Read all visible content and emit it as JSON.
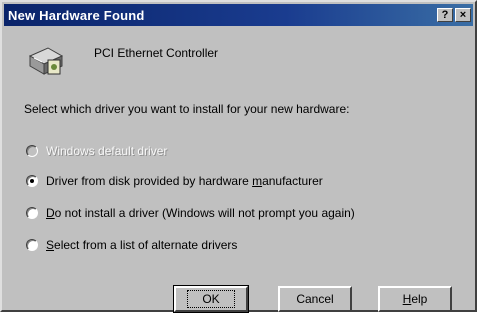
{
  "window": {
    "title": "New Hardware Found"
  },
  "titlebar_buttons": {
    "help": "?",
    "close": "×"
  },
  "device": {
    "name": "PCI Ethernet Controller",
    "icon": "hardware-device-icon"
  },
  "instruction": "Select which driver you want to install for your new hardware:",
  "options": [
    {
      "label": "Windows default driver",
      "checked": false,
      "disabled": true
    },
    {
      "label_pre": "Driver from disk provided by hardware ",
      "label_accel": "m",
      "label_post": "anufacturer",
      "checked": true,
      "disabled": false
    },
    {
      "label_pre": "",
      "label_accel": "D",
      "label_post": "o not install a driver (Windows will not prompt you again)",
      "checked": false,
      "disabled": false
    },
    {
      "label_pre": "",
      "label_accel": "S",
      "label_post": "elect from a list of alternate drivers",
      "checked": false,
      "disabled": false
    }
  ],
  "buttons": {
    "ok": "OK",
    "cancel": "Cancel",
    "help_accel": "H",
    "help_rest": "elp"
  },
  "colors": {
    "titlebar": "#0a246a",
    "face": "#c0c0c0"
  }
}
